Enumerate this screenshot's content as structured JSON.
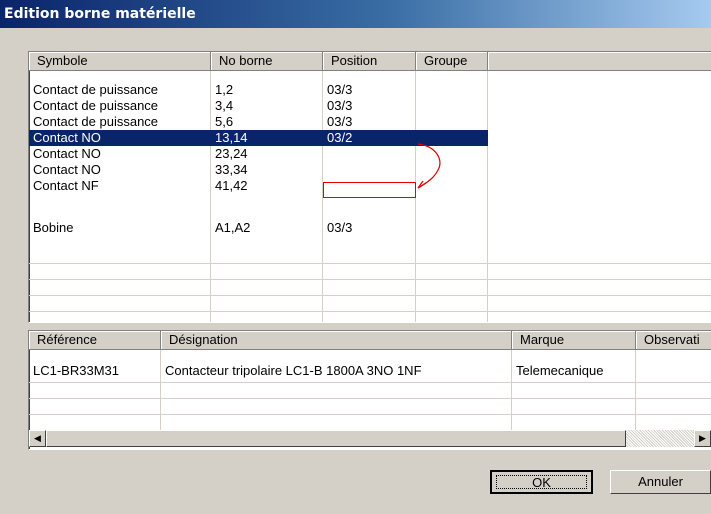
{
  "window": {
    "title": "Edition borne matérielle"
  },
  "terminals": {
    "columns": [
      "Symbole",
      "No borne",
      "Position",
      "Groupe"
    ],
    "rows": [
      {
        "symbole": "Contact de puissance",
        "no_borne": "1,2",
        "position": "03/3",
        "groupe": ""
      },
      {
        "symbole": "Contact de puissance",
        "no_borne": "3,4",
        "position": "03/3",
        "groupe": ""
      },
      {
        "symbole": "Contact de puissance",
        "no_borne": "5,6",
        "position": "03/3",
        "groupe": ""
      },
      {
        "symbole": "Contact NO",
        "no_borne": "13,14",
        "position": "03/2",
        "groupe": ""
      },
      {
        "symbole": "Contact NO",
        "no_borne": "23,24",
        "position": "",
        "groupe": ""
      },
      {
        "symbole": "Contact NO",
        "no_borne": "33,34",
        "position": "",
        "groupe": ""
      },
      {
        "symbole": "Contact NF",
        "no_borne": "41,42",
        "position": "",
        "groupe": ""
      },
      {
        "symbole": "Bobine",
        "no_borne": "A1,A2",
        "position": "03/3",
        "groupe": ""
      }
    ],
    "selected_row": 3
  },
  "parts": {
    "columns": [
      "Référence",
      "Désignation",
      "Marque",
      "Observati"
    ],
    "rows": [
      {
        "reference": "LC1-BR33M31",
        "designation": "Contacteur tripolaire LC1-B 1800A 3NO  1NF",
        "marque": "Telemecanique",
        "observation": ""
      }
    ]
  },
  "buttons": {
    "ok": "OK",
    "cancel": "Annuler"
  },
  "colors": {
    "selection": "#0a246a",
    "annotation": "#e00000"
  },
  "icons": {
    "scroll_left": "arrow-left-icon",
    "scroll_right": "arrow-right-icon"
  }
}
